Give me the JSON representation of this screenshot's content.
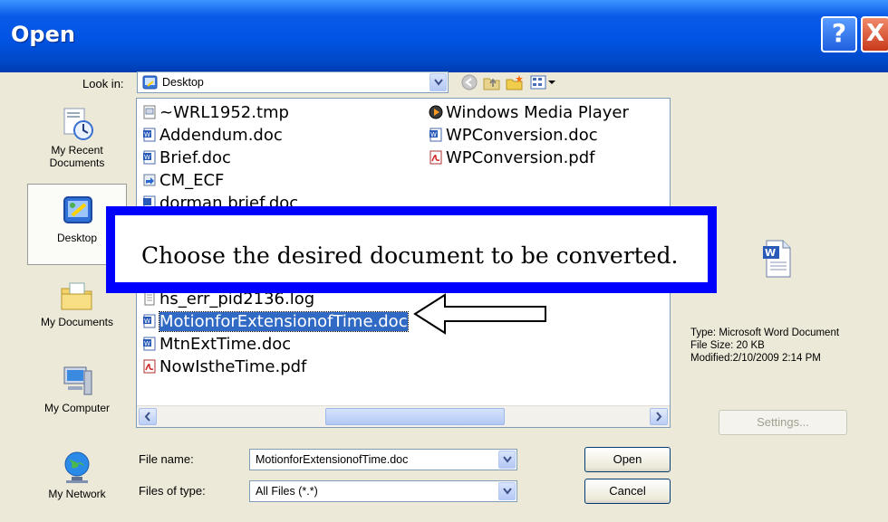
{
  "title": "Open",
  "title_buttons": {
    "help": "?",
    "close": "X"
  },
  "look_in": {
    "label": "Look in:",
    "value": "Desktop"
  },
  "toolbar_icons": [
    "back-icon",
    "up-folder-icon",
    "new-folder-icon",
    "view-menu-icon"
  ],
  "places": [
    {
      "label_line1": "My Recent",
      "label_line2": "Documents",
      "icon": "recent-documents-icon"
    },
    {
      "label_line1": "Desktop",
      "label_line2": "",
      "icon": "desktop-icon"
    },
    {
      "label_line1": "My Documents",
      "label_line2": "",
      "icon": "my-documents-icon"
    },
    {
      "label_line1": "My Computer",
      "label_line2": "",
      "icon": "my-computer-icon"
    },
    {
      "label_line1": "My Network",
      "label_line2": "",
      "icon": "my-network-icon"
    }
  ],
  "files_col1": [
    {
      "name": "~WRL1952.tmp",
      "icon": "tmp-file-icon"
    },
    {
      "name": "Addendum.doc",
      "icon": "word-doc-icon"
    },
    {
      "name": "Brief.doc",
      "icon": "word-doc-icon"
    },
    {
      "name": "CM_ECF",
      "icon": "shortcut-icon"
    },
    {
      "name": "dorman brief.doc",
      "icon": "word-doc-icon"
    },
    {
      "name": "hs_err_pid2136.log",
      "icon": "log-file-icon"
    },
    {
      "name": "MotionforExtensionofTime.doc",
      "icon": "word-doc-icon",
      "selected": true
    },
    {
      "name": "MtnExtTime.doc",
      "icon": "word-doc-icon"
    },
    {
      "name": "NowIstheTime.pdf",
      "icon": "pdf-file-icon"
    }
  ],
  "files_col2": [
    {
      "name": "Windows Media Player",
      "icon": "media-player-icon"
    },
    {
      "name": "WPConversion.doc",
      "icon": "word-doc-icon"
    },
    {
      "name": "WPConversion.pdf",
      "icon": "pdf-file-icon"
    }
  ],
  "preview": {
    "type": "Type: Microsoft Word Document",
    "size": "File Size: 20 KB",
    "modified": "Modified:2/10/2009 2:14 PM",
    "settings_button": "Settings..."
  },
  "file_name": {
    "label": "File name:",
    "value": "MotionforExtensionofTime.doc"
  },
  "file_type": {
    "label": "Files of type:",
    "value": "All Files (*.*)"
  },
  "buttons": {
    "open": "Open",
    "cancel": "Cancel"
  },
  "callout": "Choose the desired document to be converted.",
  "colors": {
    "titlebar": "#0054e3",
    "selection": "#316ac5",
    "callout_border": "#0000ff"
  }
}
